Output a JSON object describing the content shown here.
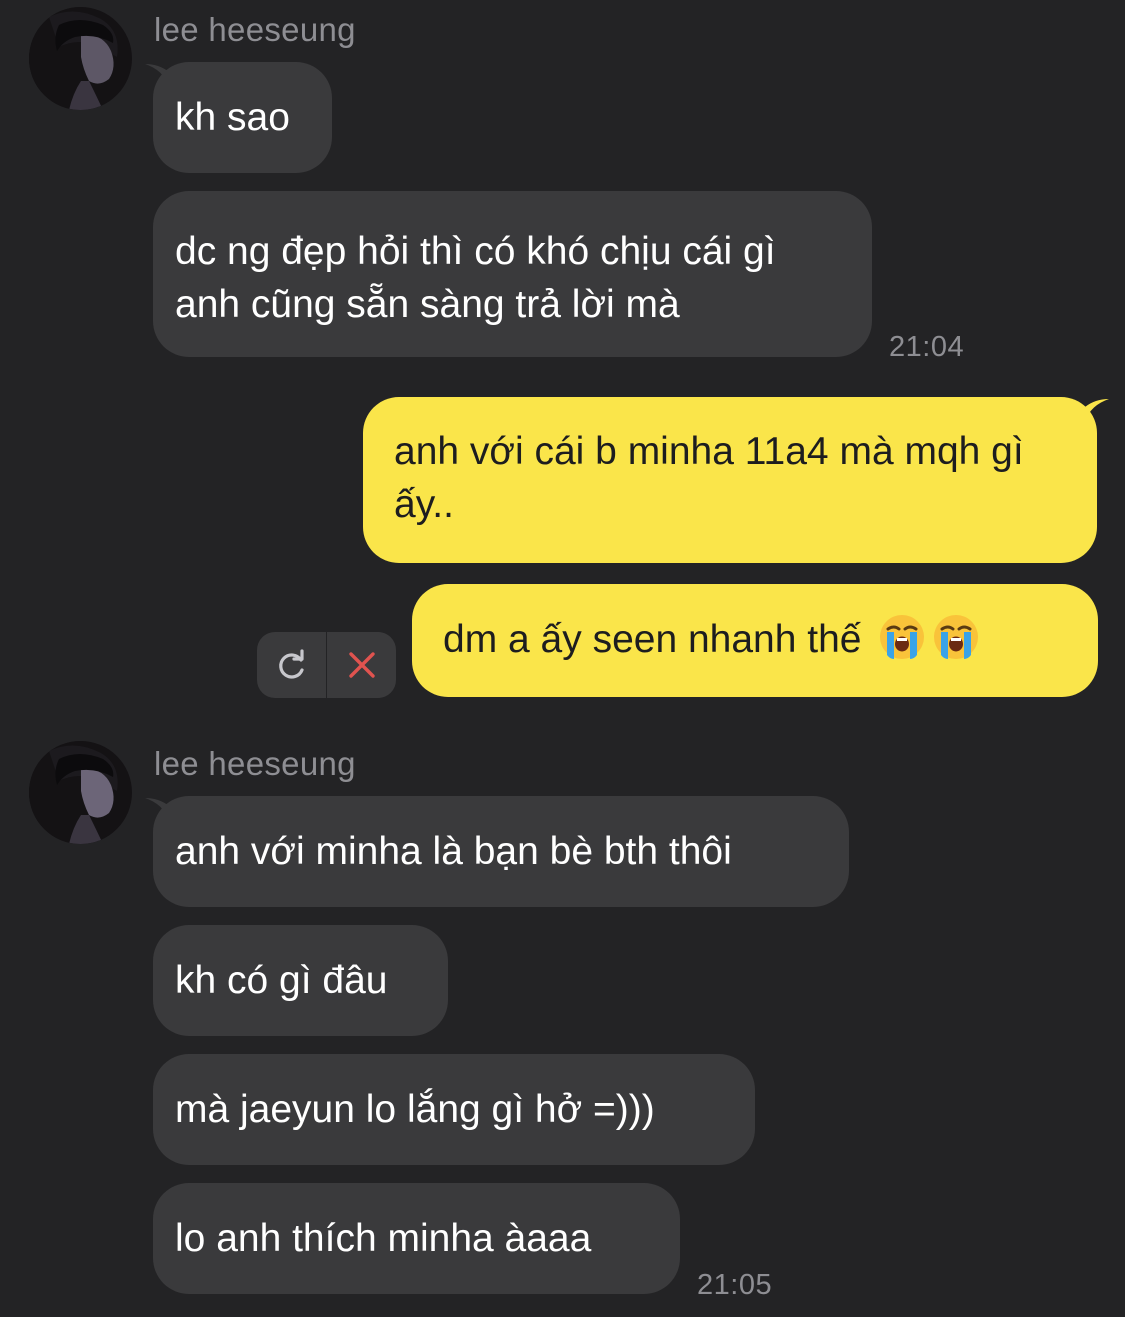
{
  "groups": [
    {
      "sender": "lee heeseung",
      "messages": [
        {
          "text": "kh sao"
        },
        {
          "text": "dc ng đẹp hỏi thì có khó chịu cái gì anh cũng sẵn sàng trả lời mà",
          "time": "21:04"
        }
      ]
    },
    {
      "sender": "lee heeseung",
      "messages": [
        {
          "text": "anh với minha là bạn bè bth thôi"
        },
        {
          "text": "kh có gì đâu"
        },
        {
          "text": "mà jaeyun lo lắng gì hở =)))"
        },
        {
          "text": "lo anh thích minha àaaa",
          "time": "21:05"
        }
      ]
    }
  ],
  "outgoing": [
    {
      "text": "anh với cái b minha 11a4 mà mqh gì ấy.."
    },
    {
      "text": "dm a ấy seen nhanh thế",
      "emojis": [
        "loudly-crying-face",
        "loudly-crying-face"
      ],
      "status": "failed"
    }
  ],
  "failed_actions": {
    "retry_icon": "retry-icon",
    "delete_icon": "close-icon"
  },
  "colors": {
    "background": "#232325",
    "incoming_bubble": "#3a3a3c",
    "outgoing_bubble": "#fae54a",
    "meta_text": "#8e8e93",
    "delete_icon": "#e0534f"
  }
}
